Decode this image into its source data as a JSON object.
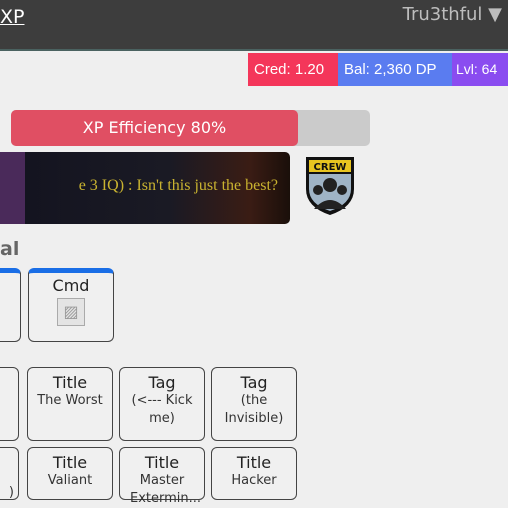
{
  "header": {
    "brand": "XP",
    "user": "Tru3thful ▼"
  },
  "stats": {
    "cred": "Cred: 1.20",
    "bal": "Bal: 2,360 DP",
    "lvl": "Lvl: 64",
    "colors": {
      "cred": "#f4365a",
      "bal": "#5a7cf0",
      "lvl": "#8a4cf0"
    }
  },
  "progress": {
    "label": "XP Efficiency 80%",
    "percent": 80
  },
  "banner": {
    "text": "e 3 IQ) : Isn't this just the best?"
  },
  "logo": {
    "text": "CREW"
  },
  "section": {
    "heading": "al"
  },
  "row1": [
    {
      "title": "Cmd",
      "icon": "broken-image-icon"
    }
  ],
  "row2": [
    {
      "title": "Title",
      "sub": "The Worst"
    },
    {
      "title": "Tag",
      "sub": "(<--- Kick me)"
    },
    {
      "title": "Tag",
      "sub": "(the Invisible)"
    }
  ],
  "row3": [
    {
      "title": "Title",
      "sub": "Valiant"
    },
    {
      "title": "Title",
      "sub": "Master Extermin..."
    },
    {
      "title": "Title",
      "sub": "Hacker"
    }
  ],
  "partial": {
    "row3_sub": ")"
  }
}
